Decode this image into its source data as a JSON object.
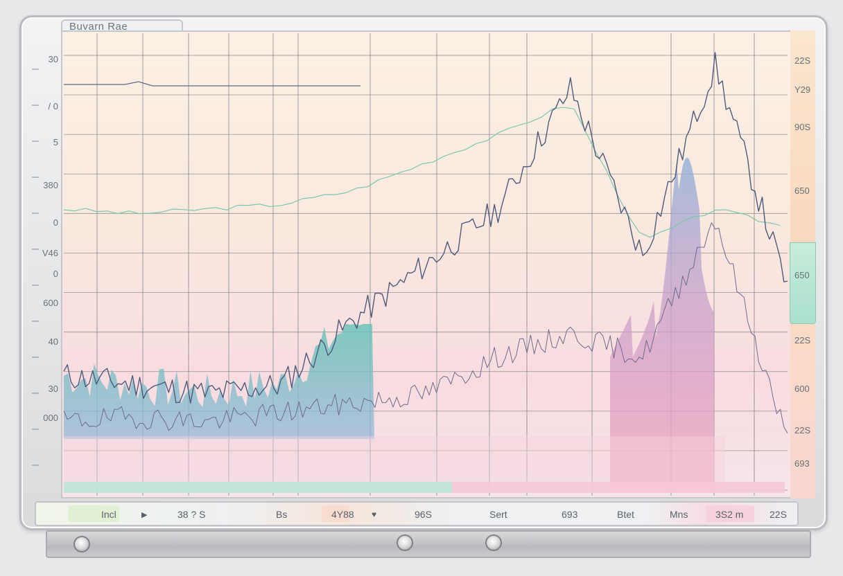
{
  "window": {
    "title": "Buvarn Rae"
  },
  "colors": {
    "line_dark": "#4d5a7a",
    "line_green": "#7cc7ae",
    "area_teal": "#69c4b8",
    "area_pink": "#f2a2bb",
    "grid": "#7c7f85"
  },
  "chart_data": {
    "type": "line",
    "title": "Buvarn Rae",
    "xlabel": "",
    "ylabel": "",
    "grid": true,
    "left_ticks": [
      "30",
      "/ 0",
      "5",
      "380",
      "0",
      "V46",
      "0",
      "600",
      "40",
      "30",
      "000"
    ],
    "right_ticks": [
      "22S",
      "Y29",
      "90S",
      "650",
      "650",
      "22S",
      "600",
      "22S",
      "693"
    ],
    "bottom_labels": [
      "Incl",
      "38 ? S",
      "Bs",
      "4Y88",
      "96S",
      "Sert",
      "693",
      "Btet",
      "Mns",
      "3S2 m",
      "22S"
    ],
    "x": [
      0,
      10,
      20,
      30,
      40,
      50,
      60,
      70,
      80,
      90,
      100
    ],
    "series": [
      {
        "values": [
          0.62,
          0.61,
          0.62,
          0.63,
          0.66,
          0.72,
          0.78,
          0.85,
          0.55,
          0.62,
          0.58
        ]
      },
      {
        "values": [
          0.26,
          0.24,
          0.22,
          0.24,
          0.38,
          0.5,
          0.62,
          0.88,
          0.52,
          0.93,
          0.45
        ]
      },
      {
        "values": [
          0.16,
          0.17,
          0.16,
          0.18,
          0.2,
          0.22,
          0.3,
          0.35,
          0.3,
          0.6,
          0.12
        ]
      }
    ]
  }
}
